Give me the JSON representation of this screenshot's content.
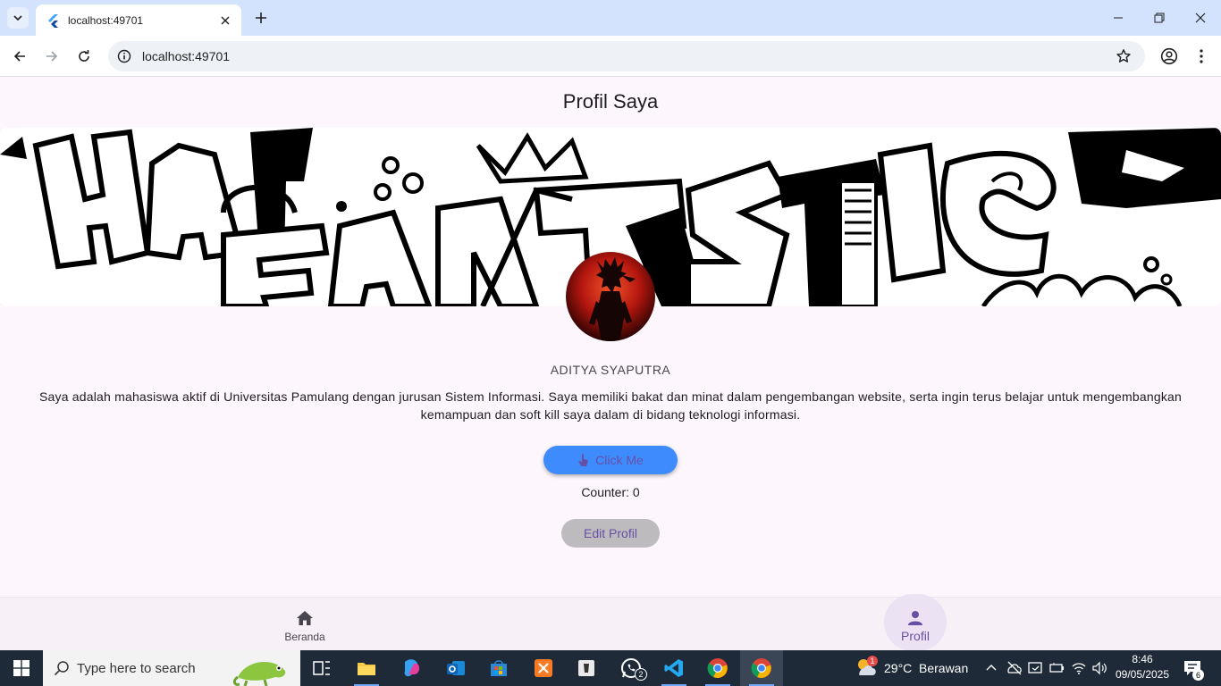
{
  "browser": {
    "tab_title": "localhost:49701",
    "url": "localhost:49701"
  },
  "app": {
    "title": "Profil Saya",
    "name": "ADITYA SYAPUTRA",
    "bio": "Saya adalah mahasiswa aktif di Universitas Pamulang dengan jurusan Sistem Informasi. Saya memiliki bakat dan minat dalam pengembangan website, serta ingin terus belajar untuk mengembangkan kemampuan dan soft kill saya dalam di bidang teknologi informasi.",
    "click_button_label": "Click Me",
    "counter_label": "Counter: 0",
    "counter_value": 0,
    "edit_button_label": "Edit Profil",
    "banner_text": "HAVE FANTASTIC",
    "accent_color": "#6750a4",
    "click_button_color": "#3d8bfd"
  },
  "bottom_nav": {
    "items": [
      {
        "label": "Beranda",
        "icon": "home-icon",
        "active": false
      },
      {
        "label": "Profil",
        "icon": "person-icon",
        "active": true
      }
    ]
  },
  "taskbar": {
    "search_placeholder": "Type here to search",
    "weather_temp": "29°C",
    "weather_desc": "Berawan",
    "weather_badge": "1",
    "whatsapp_badge": "2",
    "time": "8:46",
    "date": "09/05/2025",
    "notification_count": "6"
  }
}
